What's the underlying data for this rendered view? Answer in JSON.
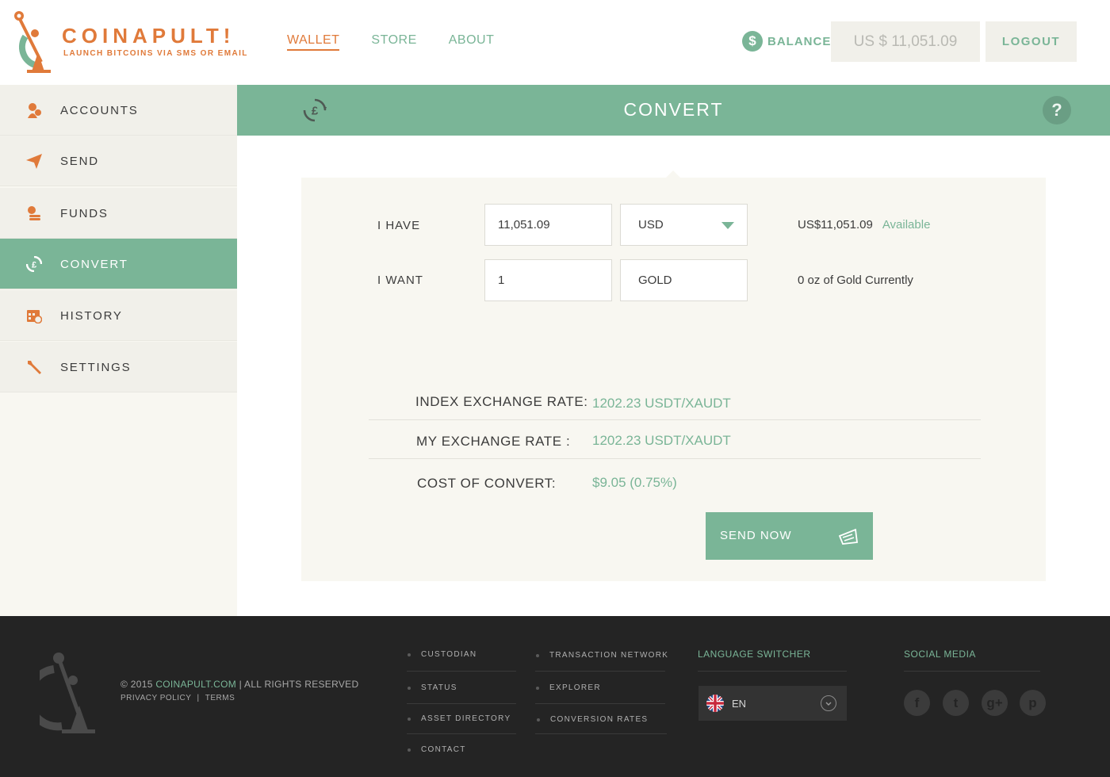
{
  "header": {
    "brand": "COINAPULT!",
    "tagline": "LAUNCH BITCOINS VIA SMS OR EMAIL",
    "nav": [
      "WALLET",
      "STORE",
      "ABOUT"
    ],
    "balance_icon": "$",
    "balance_label": "BALANCE",
    "balance_value": "US $ 11,051.09",
    "logout_label": "LOGOUT"
  },
  "sidebar": {
    "items": [
      {
        "label": "ACCOUNTS",
        "icon": "accounts-icon"
      },
      {
        "label": "SEND",
        "icon": "paper-plane-icon"
      },
      {
        "label": "FUNDS",
        "icon": "coins-icon"
      },
      {
        "label": "CONVERT",
        "icon": "convert-icon",
        "active": true
      },
      {
        "label": "HISTORY",
        "icon": "calendar-icon"
      },
      {
        "label": "SETTINGS",
        "icon": "wrench-icon"
      }
    ]
  },
  "convert": {
    "title": "CONVERT",
    "help": "?",
    "have": {
      "label": "I HAVE",
      "amount": "11,051.09",
      "currency": "USD",
      "info_amount": "US$11,051.09",
      "info_status": "Available"
    },
    "want": {
      "label": "I WANT",
      "amount": "1",
      "currency": "GOLD",
      "info": "0 oz of Gold Currently"
    },
    "rates": [
      {
        "label": "INDEX EXCHANGE RATE:",
        "value": "1202.23 USDT/XAUDT"
      },
      {
        "label": "MY EXCHANGE RATE :",
        "value": "1202.23 USDT/XAUDT"
      },
      {
        "label": "COST OF CONVERT:",
        "value": "$9.05 (0.75%)"
      }
    ],
    "send_label": "SEND NOW"
  },
  "footer": {
    "copyright_prefix": "© 2015",
    "copyright_site": "COINAPULT.COM",
    "copyright_suffix": "| ALL RIGHTS RESERVED",
    "privacy": "PRIVACY POLICY",
    "legal_sep": "|",
    "terms": "TERMS",
    "links_col1": [
      "CUSTODIAN",
      "STATUS",
      "ASSET DIRECTORY",
      "CONTACT"
    ],
    "links_col2": [
      "TRANSACTION NETWORK",
      "EXPLORER",
      "CONVERSION RATES"
    ],
    "language_heading": "LANGUAGE SWITCHER",
    "language_code": "EN",
    "social_heading": "SOCIAL MEDIA",
    "social": [
      {
        "icon": "facebook-icon",
        "glyph": "f"
      },
      {
        "icon": "twitter-icon",
        "glyph": "t"
      },
      {
        "icon": "google-plus-icon",
        "glyph": "g+"
      },
      {
        "icon": "pinterest-icon",
        "glyph": "p"
      }
    ]
  },
  "colors": {
    "accent_green": "#7ab597",
    "accent_orange": "#e07a3a",
    "footer_bg": "#242424"
  }
}
